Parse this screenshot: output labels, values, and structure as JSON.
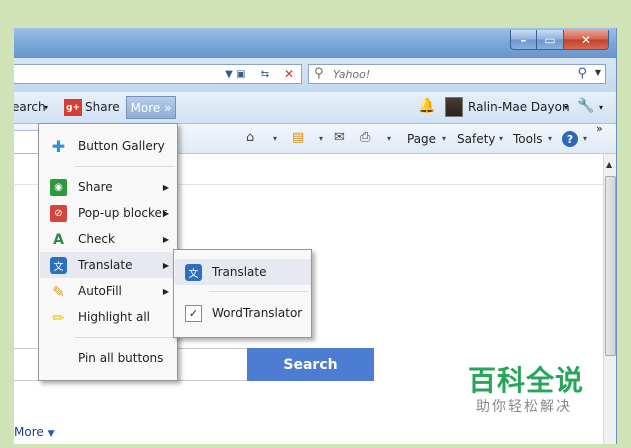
{
  "address_bar": {
    "search_placeholder": "Yahoo!",
    "icons": [
      "dropdown-arrow-icon",
      "compatibility-icon",
      "refresh-icon",
      "stop-icon",
      "search-icon",
      "go-icon"
    ]
  },
  "command_bar": {
    "search_fragment": "earch",
    "share_label": "Share",
    "more_label": "More »",
    "user_name": "Ralin-Mae Dayon"
  },
  "toolbar": {
    "page_label": "Page",
    "safety_label": "Safety",
    "tools_label": "Tools",
    "overflow_label": "»"
  },
  "more_menu": {
    "items": [
      {
        "label": "Button Gallery",
        "icon": "button-gallery-icon",
        "has_submenu": false
      },
      {
        "label": "Share",
        "icon": "share-icon",
        "has_submenu": true
      },
      {
        "label": "Pop-up blocker",
        "icon": "popup-blocker-icon",
        "has_submenu": true
      },
      {
        "label": "Check",
        "icon": "check-icon",
        "has_submenu": true
      },
      {
        "label": "Translate",
        "icon": "translate-icon",
        "has_submenu": true,
        "highlighted": true
      },
      {
        "label": "AutoFill",
        "icon": "autofill-icon",
        "has_submenu": true
      },
      {
        "label": "Highlight all",
        "icon": "highlight-icon",
        "has_submenu": false
      },
      {
        "label": "Pin all buttons",
        "icon": "",
        "has_submenu": false
      }
    ]
  },
  "translate_submenu": {
    "items": [
      {
        "label": "Translate",
        "icon": "translate-icon",
        "highlighted": true
      },
      {
        "label": "WordTranslator",
        "icon": "checkbox-icon",
        "checked": true
      }
    ]
  },
  "page": {
    "search_button": "Search",
    "more_link": "More"
  },
  "watermark": {
    "title": "百科全说",
    "subtitle": "助你轻松解决"
  },
  "colors": {
    "accent": "#4d7cd3",
    "title_bar": "#7ea9d9",
    "watermark_green": "#27a65a",
    "background": "#cfe3b7"
  }
}
